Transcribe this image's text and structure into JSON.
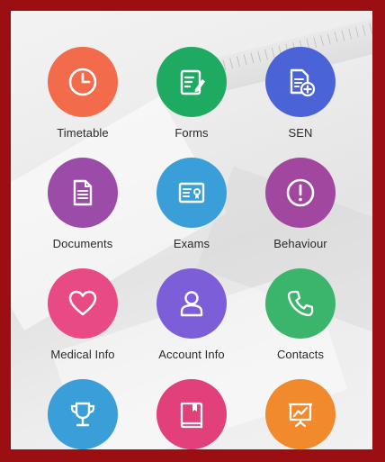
{
  "colors": {
    "frame": "#9b0f12",
    "timetable": "#f26b4a",
    "forms": "#1faa61",
    "sen": "#4a63d6",
    "documents": "#9b4ca8",
    "exams": "#3a9ed8",
    "behaviour": "#a2479f",
    "medical": "#e84a86",
    "account": "#7b5ed8",
    "contacts": "#3bb46c",
    "trophy": "#3a9ed8",
    "book": "#e1407a",
    "presentation": "#f08a2c"
  },
  "tiles": [
    {
      "label": "Timetable",
      "icon": "clock-icon"
    },
    {
      "label": "Forms",
      "icon": "form-edit-icon"
    },
    {
      "label": "SEN",
      "icon": "document-plus-icon"
    },
    {
      "label": "Documents",
      "icon": "document-icon"
    },
    {
      "label": "Exams",
      "icon": "certificate-icon"
    },
    {
      "label": "Behaviour",
      "icon": "exclamation-icon"
    },
    {
      "label": "Medical Info",
      "icon": "heart-icon"
    },
    {
      "label": "Account Info",
      "icon": "user-icon"
    },
    {
      "label": "Contacts",
      "icon": "phone-icon"
    },
    {
      "label": "",
      "icon": "trophy-icon"
    },
    {
      "label": "",
      "icon": "book-icon"
    },
    {
      "label": "",
      "icon": "presentation-icon"
    }
  ]
}
